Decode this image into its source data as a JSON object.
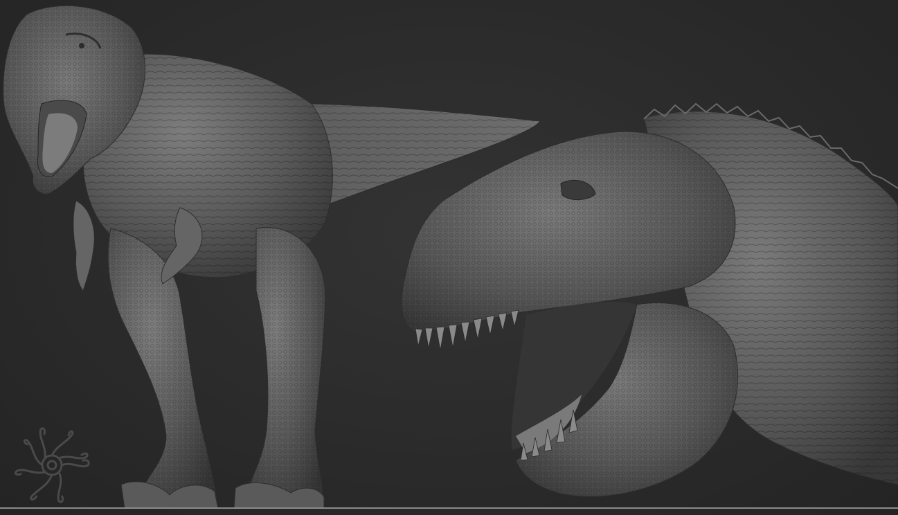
{
  "scene": {
    "subject_left": "t-rex-full-body-sculpt",
    "subject_right": "t-rex-head-closeup-sculpt",
    "logo": "spiral-sun-watermark",
    "colors": {
      "background": "#2b2b2b",
      "clay_light": "#7a7a7a",
      "clay_mid": "#5c5c5c",
      "clay_dark": "#3a3a3a",
      "watermark": "#4a4a4a"
    }
  }
}
